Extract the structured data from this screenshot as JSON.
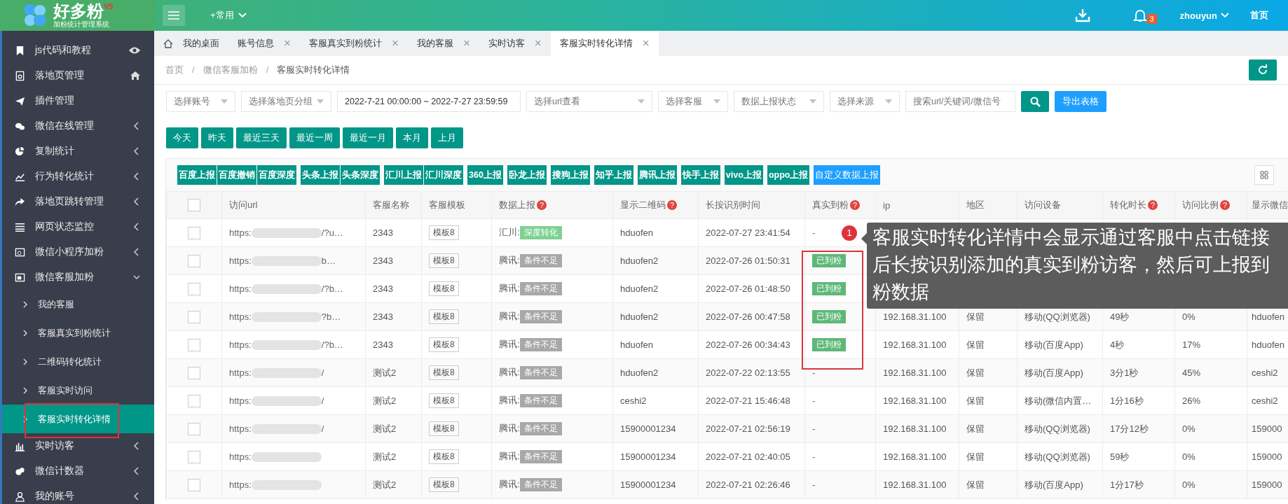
{
  "header": {
    "logo": {
      "name": "好多粉",
      "version": "V5",
      "subtitle": "加粉统计管理系统"
    },
    "quick_menu": "+常用",
    "notification_count": "3",
    "user": "zhouyun",
    "home_link": "首页"
  },
  "sidebar": {
    "items": [
      {
        "label": "js代码和教程"
      },
      {
        "label": "落地页管理"
      },
      {
        "label": "插件管理"
      },
      {
        "label": "微信在线管理",
        "expanded": false
      },
      {
        "label": "复制统计",
        "expanded": false
      },
      {
        "label": "行为转化统计",
        "expanded": false
      },
      {
        "label": "落地页跳转管理",
        "expanded": false
      },
      {
        "label": "网页状态监控",
        "expanded": false
      },
      {
        "label": "微信小程序加粉",
        "expanded": false
      },
      {
        "label": "微信客服加粉",
        "expanded": true,
        "children": [
          {
            "label": "我的客服",
            "selected": false
          },
          {
            "label": "客服真实到粉统计",
            "selected": false
          },
          {
            "label": "二维码转化统计",
            "selected": false
          },
          {
            "label": "客服实时访问",
            "selected": false
          },
          {
            "label": "客服实时转化详情",
            "selected": true
          }
        ]
      },
      {
        "label": "实时访客",
        "expanded": false
      },
      {
        "label": "微信计数器",
        "expanded": false
      },
      {
        "label": "我的账号",
        "expanded": false
      }
    ]
  },
  "tabs": [
    {
      "label": "我的桌面",
      "selected": false
    },
    {
      "label": "账号信息",
      "selected": false,
      "close": "×"
    },
    {
      "label": "客服真实到粉统计",
      "selected": false,
      "close": "×"
    },
    {
      "label": "我的客服",
      "selected": false,
      "close": "×"
    },
    {
      "label": "实时访客",
      "selected": false,
      "close": "×"
    },
    {
      "label": "客服实时转化详情",
      "selected": true,
      "close": "×"
    }
  ],
  "breadcrumb": {
    "separator": "/",
    "items": [
      "首页",
      "微信客服加粉",
      "客服实时转化详情"
    ]
  },
  "filters": [
    {
      "kind": "select",
      "placeholder": "选择账号"
    },
    {
      "kind": "select",
      "placeholder": "选择落地页分组"
    },
    {
      "kind": "date",
      "value": "2022-7-21 00:00:00 ~ 2022-7-27 23:59:59"
    },
    {
      "kind": "select",
      "placeholder": "选择url查看"
    },
    {
      "kind": "select",
      "placeholder": "选择客服"
    },
    {
      "kind": "select",
      "placeholder": "数据上报状态"
    },
    {
      "kind": "select",
      "placeholder": "选择来源"
    },
    {
      "kind": "search",
      "placeholder": "搜索url/关键词/微信号"
    }
  ],
  "export_button": "导出表格",
  "date_buttons": [
    "今天",
    "昨天",
    "最近三天",
    "最近一周",
    "最近一月",
    "本月",
    "上月"
  ],
  "report_button_groups": [
    {
      "buttons": [
        {
          "label": "百度上报",
          "kind": "primary"
        },
        {
          "label": "百度撤销",
          "kind": "primary"
        },
        {
          "label": "百度深度",
          "kind": "primary"
        }
      ]
    },
    {
      "buttons": [
        {
          "label": "头条上报",
          "kind": "primary"
        },
        {
          "label": "头条深度",
          "kind": "primary"
        }
      ]
    },
    {
      "buttons": [
        {
          "label": "汇川上报",
          "kind": "primary"
        },
        {
          "label": "汇川深度",
          "kind": "primary"
        }
      ]
    },
    {
      "buttons": [
        {
          "label": "360上报",
          "kind": "primary"
        }
      ]
    },
    {
      "buttons": [
        {
          "label": "卧龙上报",
          "kind": "primary"
        }
      ]
    },
    {
      "buttons": [
        {
          "label": "搜狗上报",
          "kind": "primary"
        }
      ]
    },
    {
      "buttons": [
        {
          "label": "知乎上报",
          "kind": "primary"
        }
      ]
    },
    {
      "buttons": [
        {
          "label": "腾讯上报",
          "kind": "primary"
        }
      ]
    },
    {
      "buttons": [
        {
          "label": "快手上报",
          "kind": "primary"
        }
      ]
    },
    {
      "buttons": [
        {
          "label": "vivo上报",
          "kind": "primary"
        }
      ]
    },
    {
      "buttons": [
        {
          "label": "oppo上报",
          "kind": "primary"
        }
      ]
    },
    {
      "buttons": [
        {
          "label": "自定义数据上报",
          "kind": "custom"
        }
      ]
    }
  ],
  "table": {
    "select_all_checked": false,
    "columns": [
      {
        "label": "访问url"
      },
      {
        "label": "客服名称"
      },
      {
        "label": "客服模板"
      },
      {
        "label": "数据上报",
        "help": "?"
      },
      {
        "label": "显示二维码",
        "help": "?"
      },
      {
        "label": "长按识别时间"
      },
      {
        "label": "真实到粉",
        "help": "?"
      },
      {
        "label": "ip"
      },
      {
        "label": "地区"
      },
      {
        "label": "访问设备"
      },
      {
        "label": "转化时长",
        "help": "?"
      },
      {
        "label": "访问比例",
        "help": "?"
      },
      {
        "label": "显示微信"
      }
    ],
    "rows": [
      {
        "checked": false,
        "url_prefix": "https:",
        "url_suffix": "/?u…",
        "name": "2343",
        "template": "模板8",
        "platform": "汇川:",
        "report_tag": {
          "kind": "success",
          "label": "深度转化"
        },
        "qrcode": "hduofen",
        "time": "2022-07-27 23:41:54",
        "fan": {
          "kind": "none",
          "label": "-"
        }
      },
      {
        "checked": false,
        "url_prefix": "https:",
        "url_suffix": "b…",
        "name": "2343",
        "template": "模板8",
        "platform": "腾讯:",
        "report_tag": {
          "kind": "insufficient",
          "label": "条件不足"
        },
        "qrcode": "hduofen2",
        "time": "2022-07-26 01:50:31",
        "fan": {
          "kind": "arrived",
          "label": "已到粉"
        }
      },
      {
        "checked": false,
        "url_prefix": "https:",
        "url_suffix": "/?b…",
        "name": "2343",
        "template": "模板8",
        "platform": "腾讯:",
        "report_tag": {
          "kind": "insufficient",
          "label": "条件不足"
        },
        "qrcode": "hduofen2",
        "time": "2022-07-26 01:48:50",
        "fan": {
          "kind": "arrived",
          "label": "已到粉"
        }
      },
      {
        "checked": false,
        "url_prefix": "https:",
        "url_suffix": "?b…",
        "name": "2343",
        "template": "模板8",
        "platform": "腾讯:",
        "report_tag": {
          "kind": "insufficient",
          "label": "条件不足"
        },
        "qrcode": "hduofen2",
        "time": "2022-07-26 00:47:58",
        "fan": {
          "kind": "arrived",
          "label": "已到粉"
        },
        "ip": "192.168.31.100",
        "region": "保留",
        "device": "移动(QQ浏览器)",
        "duration": "49秒",
        "ratio": "0%",
        "wechat": "hduofen"
      },
      {
        "checked": false,
        "url_prefix": "https:",
        "url_suffix": "/?b…",
        "name": "2343",
        "template": "模板8",
        "platform": "腾讯:",
        "report_tag": {
          "kind": "insufficient",
          "label": "条件不足"
        },
        "qrcode": "hduofen",
        "time": "2022-07-26 00:34:43",
        "fan": {
          "kind": "arrived",
          "label": "已到粉"
        },
        "ip": "192.168.31.100",
        "region": "保留",
        "device": "移动(百度App)",
        "duration": "4秒",
        "ratio": "17%",
        "wechat": "hduofen"
      },
      {
        "checked": false,
        "url_prefix": "https:",
        "url_suffix": "/",
        "name": "测试2",
        "template": "模板8",
        "platform": "腾讯:",
        "report_tag": {
          "kind": "insufficient",
          "label": "条件不足"
        },
        "qrcode": "hduofen2",
        "time": "2022-07-22 02:13:55",
        "fan": {
          "kind": "none",
          "label": "-"
        },
        "ip": "192.168.31.100",
        "region": "保留",
        "device": "移动(百度App)",
        "duration": "3分1秒",
        "ratio": "45%",
        "wechat": "ceshi2"
      },
      {
        "checked": false,
        "url_prefix": "https:",
        "url_suffix": "/",
        "name": "测试2",
        "template": "模板8",
        "platform": "腾讯:",
        "report_tag": {
          "kind": "insufficient",
          "label": "条件不足"
        },
        "qrcode": "ceshi2",
        "time": "2022-07-21 15:46:48",
        "fan": {
          "kind": "none",
          "label": "-"
        },
        "ip": "192.168.31.100",
        "region": "保留",
        "device": "移动(微信内置…",
        "duration": "1分16秒",
        "ratio": "26%",
        "wechat": "ceshi2"
      },
      {
        "checked": false,
        "url_prefix": "https:",
        "url_suffix": "/",
        "name": "测试2",
        "template": "模板8",
        "platform": "腾讯:",
        "report_tag": {
          "kind": "insufficient",
          "label": "条件不足"
        },
        "qrcode": "15900001234",
        "time": "2022-07-21 02:56:19",
        "fan": {
          "kind": "none",
          "label": "-"
        },
        "ip": "192.168.31.100",
        "region": "保留",
        "device": "移动(QQ浏览器)",
        "duration": "17分12秒",
        "ratio": "0%",
        "wechat": "159000"
      },
      {
        "checked": false,
        "url_prefix": "https:",
        "name": "测试2",
        "template": "模板8",
        "platform": "腾讯:",
        "report_tag": {
          "kind": "insufficient",
          "label": "条件不足"
        },
        "qrcode": "15900001234",
        "time": "2022-07-21 02:40:05",
        "fan": {
          "kind": "none",
          "label": "-"
        },
        "ip": "192.168.31.100",
        "region": "保留",
        "device": "移动(QQ浏览器)",
        "duration": "59秒",
        "ratio": "0%",
        "wechat": "159000"
      },
      {
        "checked": false,
        "url_prefix": "https:",
        "name": "测试2",
        "template": "模板8",
        "platform": "腾讯:",
        "report_tag": {
          "kind": "insufficient",
          "label": "条件不足"
        },
        "qrcode": "15900001234",
        "time": "2022-07-21 02:26:46",
        "fan": {
          "kind": "none",
          "label": "-"
        },
        "ip": "192.168.31.100",
        "region": "保留",
        "device": "移动(百度App)",
        "duration": "1分17秒",
        "ratio": "0%",
        "wechat": "159000"
      }
    ]
  },
  "callout": {
    "badge": "1",
    "text": "客服实时转化详情中会显示通过客服中点击链接后长按识别添加的真实到粉访客，然后可上报到粉数据"
  }
}
